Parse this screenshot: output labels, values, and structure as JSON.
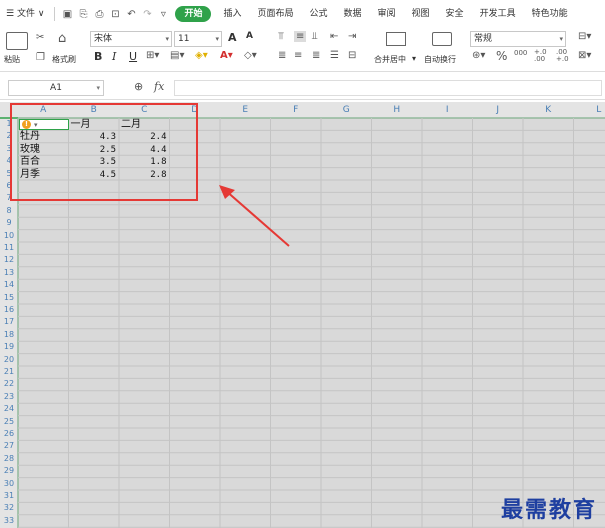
{
  "menubar": {
    "hamburger": "☰",
    "file": "文件",
    "chevron": "∨",
    "items": [
      "开始",
      "插入",
      "页面布局",
      "公式",
      "数据",
      "审阅",
      "视图",
      "安全",
      "开发工具",
      "特色功能"
    ]
  },
  "ribbon": {
    "paste_label": "粘贴",
    "format_painter_label": "格式刷",
    "font_name": "宋体",
    "font_size": "11",
    "grow_font": "A",
    "shrink_font": "A",
    "bold": "B",
    "italic": "I",
    "underline": "U",
    "merge_label": "合并居中",
    "wrap_label": "自动换行",
    "number_format": "常规",
    "percent": "%",
    "thousands": "000",
    "inc_decimal": "+.0 .00",
    "dec_decimal": ".00 +.0"
  },
  "formulabar": {
    "namebox": "A1",
    "fx": "fx"
  },
  "sheet": {
    "columns": [
      "A",
      "B",
      "C",
      "D",
      "E",
      "F",
      "G",
      "H",
      "I",
      "J",
      "K",
      "L"
    ],
    "rows": [
      "1",
      "2",
      "3",
      "4",
      "5",
      "6",
      "7",
      "8",
      "9",
      "10",
      "11",
      "12",
      "13",
      "14",
      "15",
      "16",
      "17",
      "18",
      "19",
      "20",
      "21",
      "22",
      "23",
      "24",
      "25",
      "26",
      "27",
      "28",
      "29",
      "30",
      "31",
      "32",
      "33"
    ],
    "header_row": [
      "",
      "一月",
      "二月"
    ],
    "data": [
      [
        "牡丹",
        "4.3",
        "2.4"
      ],
      [
        "玫瑰",
        "2.5",
        "4.4"
      ],
      [
        "百合",
        "3.5",
        "1.8"
      ],
      [
        "月季",
        "4.5",
        "2.8"
      ]
    ]
  },
  "watermark": "最需教育",
  "colors": {
    "accent_green": "#2fa24a",
    "highlight_red": "#e53935",
    "header_blue": "#4a7fb5",
    "watermark_blue": "#1e3fa0"
  }
}
